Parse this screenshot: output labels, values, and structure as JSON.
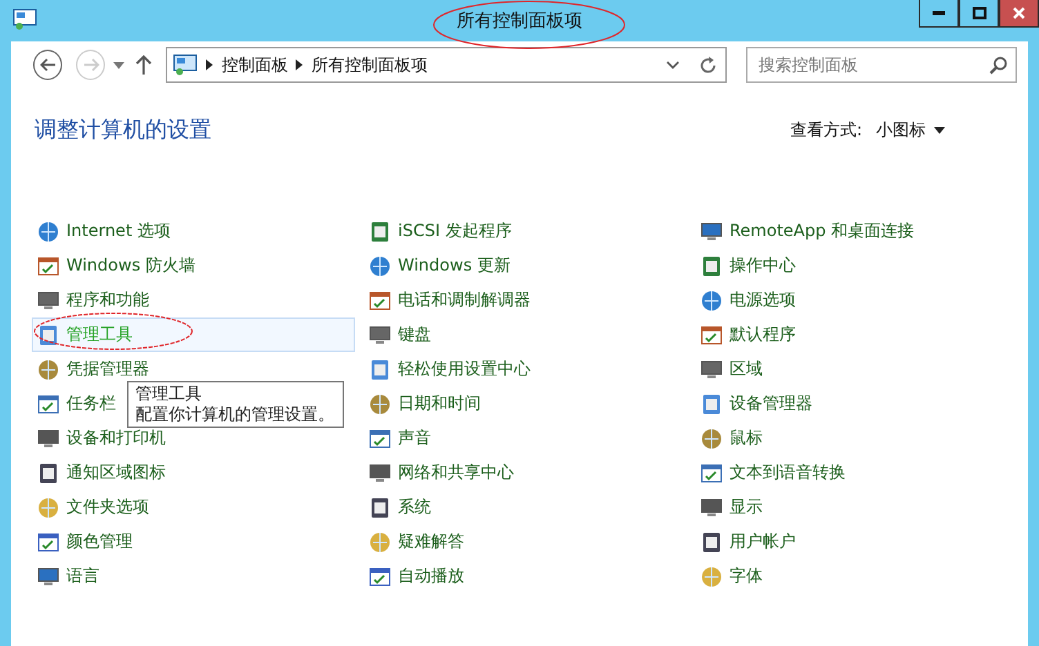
{
  "window": {
    "title": "所有控制面板项"
  },
  "nav": {
    "back_disabled": false,
    "forward_disabled": true
  },
  "address_bar": {
    "crumbs": [
      "控制面板",
      "所有控制面板项"
    ]
  },
  "search": {
    "placeholder": "搜索控制面板"
  },
  "heading": "调整计算机的设置",
  "view": {
    "label": "查看方式:",
    "value": "小图标"
  },
  "columns": [
    [
      {
        "label": "Internet 选项",
        "hovered": false
      },
      {
        "label": "Windows 防火墙",
        "hovered": false
      },
      {
        "label": "程序和功能",
        "hovered": false
      },
      {
        "label": "管理工具",
        "hovered": true
      },
      {
        "label": "凭据管理器",
        "hovered": false
      },
      {
        "label": "任务栏",
        "hovered": false
      },
      {
        "label": "设备和打印机",
        "hovered": false
      },
      {
        "label": "通知区域图标",
        "hovered": false
      },
      {
        "label": "文件夹选项",
        "hovered": false
      },
      {
        "label": "颜色管理",
        "hovered": false
      },
      {
        "label": "语言",
        "hovered": false
      }
    ],
    [
      {
        "label": "iSCSI 发起程序",
        "hovered": false
      },
      {
        "label": "Windows 更新",
        "hovered": false
      },
      {
        "label": "电话和调制解调器",
        "hovered": false
      },
      {
        "label": "键盘",
        "hovered": false
      },
      {
        "label": "轻松使用设置中心",
        "hovered": false
      },
      {
        "label": "日期和时间",
        "hovered": false
      },
      {
        "label": "声音",
        "hovered": false
      },
      {
        "label": "网络和共享中心",
        "hovered": false
      },
      {
        "label": "系统",
        "hovered": false
      },
      {
        "label": "疑难解答",
        "hovered": false
      },
      {
        "label": "自动播放",
        "hovered": false
      }
    ],
    [
      {
        "label": "RemoteApp 和桌面连接",
        "hovered": false
      },
      {
        "label": "操作中心",
        "hovered": false
      },
      {
        "label": "电源选项",
        "hovered": false
      },
      {
        "label": "默认程序",
        "hovered": false
      },
      {
        "label": "区域",
        "hovered": false
      },
      {
        "label": "设备管理器",
        "hovered": false
      },
      {
        "label": "鼠标",
        "hovered": false
      },
      {
        "label": "文本到语音转换",
        "hovered": false
      },
      {
        "label": "显示",
        "hovered": false
      },
      {
        "label": "用户帐户",
        "hovered": false
      },
      {
        "label": "字体",
        "hovered": false
      }
    ]
  ],
  "tooltip": {
    "title": "管理工具",
    "text": "配置你计算机的管理设置。"
  }
}
